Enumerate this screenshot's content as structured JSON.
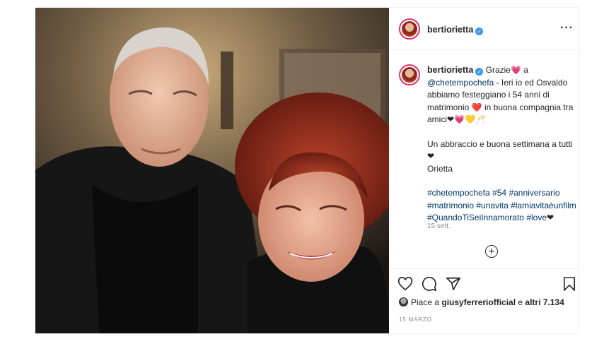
{
  "post": {
    "username": "bertiorietta",
    "more_icon": "more-dots-icon",
    "caption": {
      "username": "bertiorietta",
      "line1_a": " Grazie",
      "line1_b": " a",
      "mention": "@chetempochefa",
      "line2": " - Ieri io ed Osvaldo abbiamo festeggiano i 54 anni di matrimonio ",
      "line3": " in buona compagnia tra amici",
      "line3_emoji": "❤💗💛🥂",
      "para2": "Un abbraccio e buona settimana a tutti ❤",
      "signature": "Orietta",
      "hashtags": [
        "#chetempochefa",
        "#54",
        "#anniversario",
        "#matrimonio",
        "#unavita",
        "#lamiavitaèunfilm",
        "#QuandoTiSeiInnamorato",
        "#love"
      ],
      "hashtag_suffix": "❤",
      "emoji_heart": "💗",
      "emoji_red": "❤️"
    },
    "comment_time": "15 sett.",
    "add_comment_icon": "plus-circle-icon",
    "likes": {
      "prefix": "Piace a ",
      "user": "giusyferreriofficial",
      "middle": " e ",
      "others": "altri 7.134"
    },
    "date": "15 MARZO",
    "accent_color": "#3897f0",
    "hashtag_color": "#00376b"
  }
}
